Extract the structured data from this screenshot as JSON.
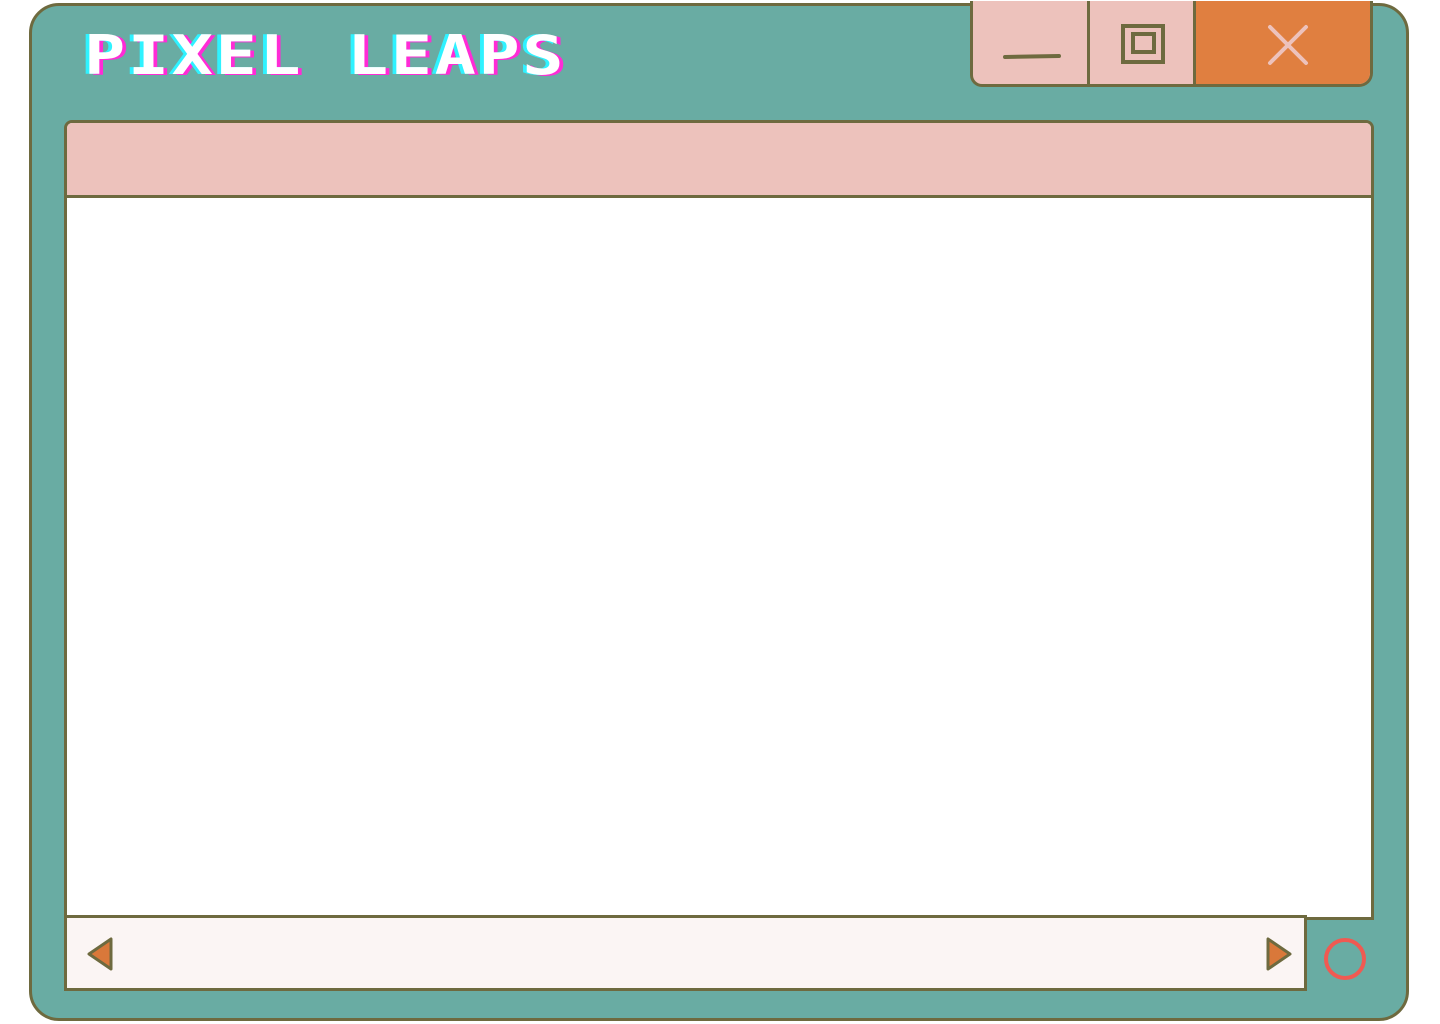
{
  "window": {
    "title": "PIXEL LEAPS",
    "controls": {
      "minimize_icon": "minimize-icon",
      "maximize_icon": "maximize-icon",
      "close_icon": "close-icon"
    }
  },
  "scrollbar": {
    "left_icon": "triangle-left-icon",
    "right_icon": "triangle-right-icon",
    "corner_icon": "ring-icon"
  },
  "colors": {
    "frame": "#69aca3",
    "outline": "#6e6a3f",
    "pink": "#edc2bc",
    "close": "#e07f40",
    "arrow": "#d9783a",
    "ring": "#f05a52",
    "title_text": "#ffffff",
    "title_shadow_cyan": "#2ff2ff",
    "title_shadow_magenta": "#ff2bd6"
  }
}
